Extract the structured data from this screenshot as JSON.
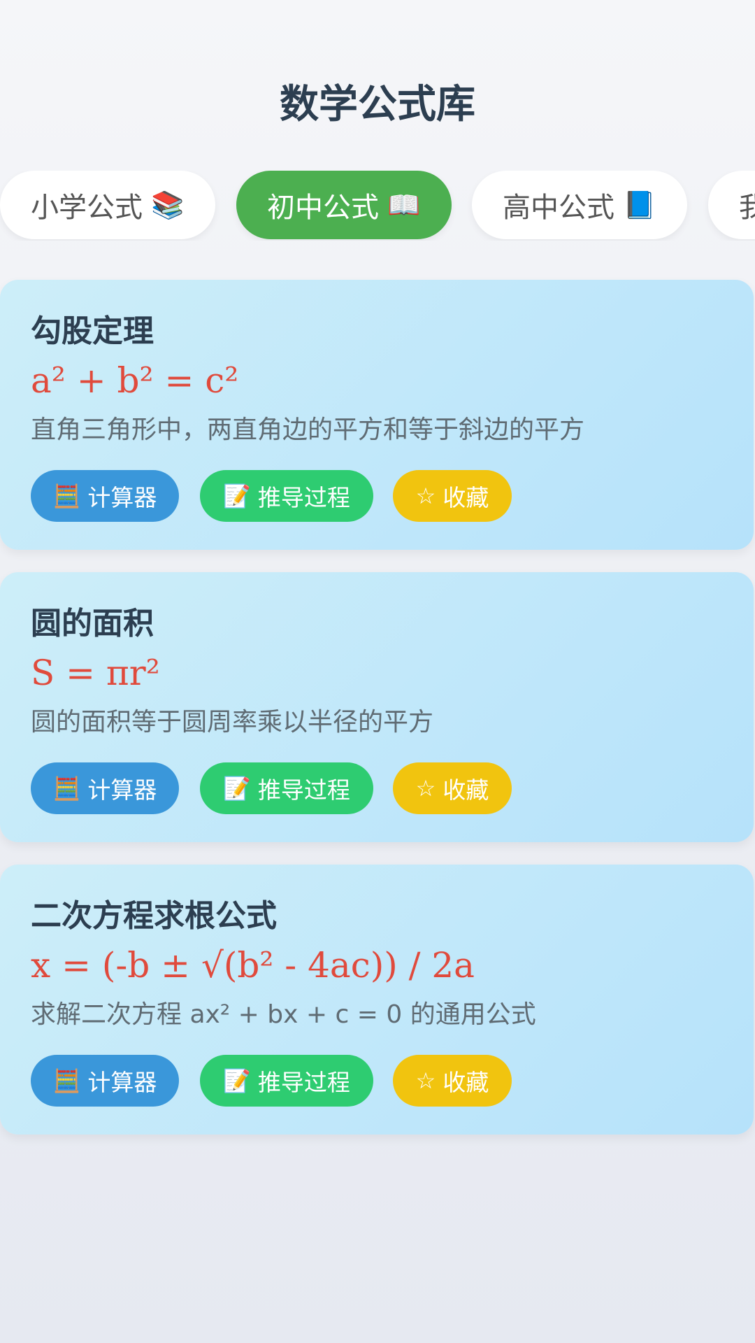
{
  "header": {
    "title": "数学公式库"
  },
  "tabs": [
    {
      "label": "小学公式",
      "icon": "📚",
      "icon_name": "books-icon",
      "active": false
    },
    {
      "label": "初中公式",
      "icon": "📖",
      "icon_name": "open-book-icon",
      "active": true
    },
    {
      "label": "高中公式",
      "icon": "📘",
      "icon_name": "blue-book-icon",
      "active": false
    },
    {
      "label": "我",
      "icon": "",
      "icon_name": "",
      "active": false
    }
  ],
  "actions": {
    "calculator": {
      "label": "计算器",
      "icon": "🧮",
      "icon_name": "abacus-icon"
    },
    "derivation": {
      "label": "推导过程",
      "icon": "📝",
      "icon_name": "memo-icon"
    },
    "favorite": {
      "label": "收藏",
      "icon": "☆",
      "icon_name": "star-outline-icon"
    }
  },
  "cards": [
    {
      "title": "勾股定理",
      "formula": "a² + b² = c²",
      "description": "直角三角形中，两直角边的平方和等于斜边的平方"
    },
    {
      "title": "圆的面积",
      "formula": "S = πr²",
      "description": "圆的面积等于圆周率乘以半径的平方"
    },
    {
      "title": "二次方程求根公式",
      "formula": "x = (-b ± √(b² - 4ac)) / 2a",
      "description": "求解二次方程 ax² + bx + c = 0 的通用公式"
    }
  ],
  "colors": {
    "active_tab": "#4caf50",
    "calculator_button": "#3a97da",
    "derivation_button": "#2ecc71",
    "favorite_button": "#f1c40f",
    "formula_text": "#e04a3c"
  }
}
